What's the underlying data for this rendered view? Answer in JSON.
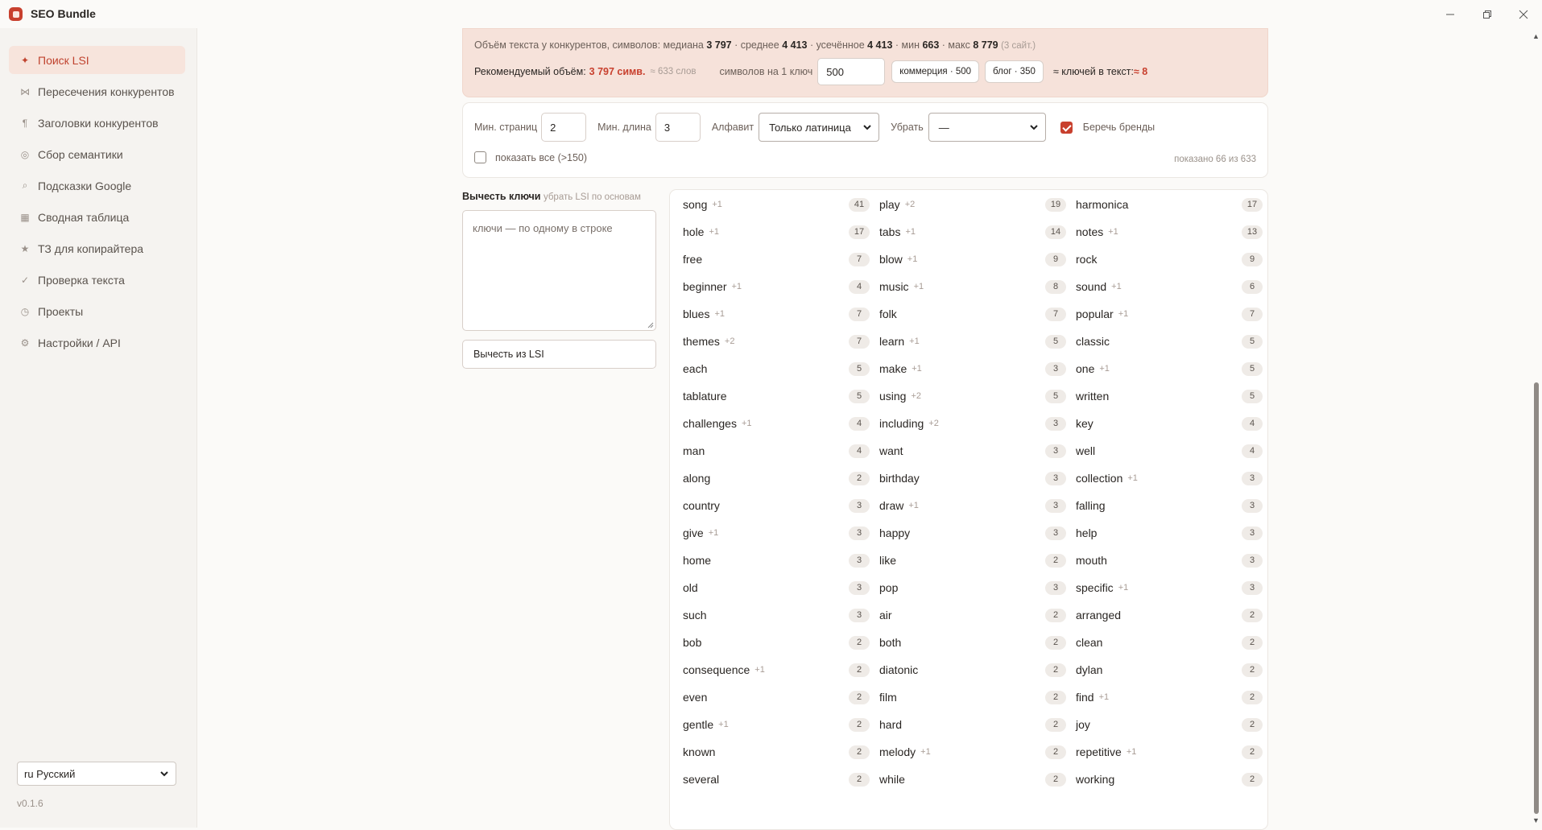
{
  "window": {
    "title": "SEO Bundle",
    "icons": [
      "minimize-icon",
      "restore-icon",
      "close-icon"
    ]
  },
  "sidebar": {
    "items": [
      {
        "label": "Поиск LSI",
        "icon": "✦",
        "active": true
      },
      {
        "label": "Пересечения конкурентов",
        "icon": "⋈"
      },
      {
        "label": "Заголовки конкурентов",
        "icon": "¶"
      },
      {
        "label": "Сбор семантики",
        "icon": "◎"
      },
      {
        "label": "Подсказки Google",
        "icon": "⌕"
      },
      {
        "label": "Сводная таблица",
        "icon": "▦"
      },
      {
        "label": "ТЗ для копирайтера",
        "icon": "★"
      },
      {
        "label": "Проверка текста",
        "icon": "✓"
      },
      {
        "label": "Проекты",
        "icon": "◷"
      },
      {
        "label": "Настройки / API",
        "icon": "⚙"
      }
    ],
    "language": "ru Русский",
    "version": "v0.1.6"
  },
  "stats": {
    "prefix": "Объём текста у конкурентов, символов: медиана ",
    "median": "3 797",
    "avg_label": " · среднее ",
    "avg": "4 413",
    "trim_label": " · усечённое ",
    "trim": "4 413",
    "min_label": " · мин ",
    "min": "663",
    "max_label": " · макс ",
    "max": "8 779",
    "sites": "(3 сайт.)",
    "recommended_label": "Рекомендуемый объём: ",
    "recommended": "3 797 симв.",
    "words": "≈ 633 слов",
    "per_key_label": "символов на 1 ключ",
    "per_key_value": "500",
    "chip_commerce": "коммерция · 500",
    "chip_blog": "блог · 350",
    "keys_label": "≈ ключей в текст: ",
    "keys_value": "≈ 8"
  },
  "filters": {
    "min_pages_label": "Мин. страниц",
    "min_pages": "2",
    "min_len_label": "Мин. длина",
    "min_len": "3",
    "alphabet_label": "Алфавит",
    "alphabet": "Только латиница",
    "remove_label": "Убрать",
    "remove": "—",
    "brands_label": "Беречь бренды",
    "brands_checked": true,
    "show_all_label": "показать все (>150)",
    "show_all_checked": false,
    "shown": "показано 66 из 633"
  },
  "subtract": {
    "title": "Вычесть ключи",
    "hint": "убрать LSI по основам",
    "placeholder": "ключи — по одному в строке",
    "button": "Вычесть из LSI"
  },
  "lsi_columns": [
    [
      {
        "w": "song",
        "p": "+1",
        "c": "41"
      },
      {
        "w": "hole",
        "p": "+1",
        "c": "17"
      },
      {
        "w": "free",
        "p": "",
        "c": "7"
      },
      {
        "w": "beginner",
        "p": "+1",
        "c": "4"
      },
      {
        "w": "blues",
        "p": "+1",
        "c": "7"
      },
      {
        "w": "themes",
        "p": "+2",
        "c": "7"
      },
      {
        "w": "each",
        "p": "",
        "c": "5"
      },
      {
        "w": "tablature",
        "p": "",
        "c": "5"
      },
      {
        "w": "challenges",
        "p": "+1",
        "c": "4"
      },
      {
        "w": "man",
        "p": "",
        "c": "4"
      },
      {
        "w": "along",
        "p": "",
        "c": "2"
      },
      {
        "w": "country",
        "p": "",
        "c": "3"
      },
      {
        "w": "give",
        "p": "+1",
        "c": "3"
      },
      {
        "w": "home",
        "p": "",
        "c": "3"
      },
      {
        "w": "old",
        "p": "",
        "c": "3"
      },
      {
        "w": "such",
        "p": "",
        "c": "3"
      },
      {
        "w": "bob",
        "p": "",
        "c": "2"
      },
      {
        "w": "consequence",
        "p": "+1",
        "c": "2"
      },
      {
        "w": "even",
        "p": "",
        "c": "2"
      },
      {
        "w": "gentle",
        "p": "+1",
        "c": "2"
      },
      {
        "w": "known",
        "p": "",
        "c": "2"
      },
      {
        "w": "several",
        "p": "",
        "c": "2"
      }
    ],
    [
      {
        "w": "play",
        "p": "+2",
        "c": "19"
      },
      {
        "w": "tabs",
        "p": "+1",
        "c": "14"
      },
      {
        "w": "blow",
        "p": "+1",
        "c": "9"
      },
      {
        "w": "music",
        "p": "+1",
        "c": "8"
      },
      {
        "w": "folk",
        "p": "",
        "c": "7"
      },
      {
        "w": "learn",
        "p": "+1",
        "c": "5"
      },
      {
        "w": "make",
        "p": "+1",
        "c": "3"
      },
      {
        "w": "using",
        "p": "+2",
        "c": "5"
      },
      {
        "w": "including",
        "p": "+2",
        "c": "3"
      },
      {
        "w": "want",
        "p": "",
        "c": "3"
      },
      {
        "w": "birthday",
        "p": "",
        "c": "3"
      },
      {
        "w": "draw",
        "p": "+1",
        "c": "3"
      },
      {
        "w": "happy",
        "p": "",
        "c": "3"
      },
      {
        "w": "like",
        "p": "",
        "c": "2"
      },
      {
        "w": "pop",
        "p": "",
        "c": "3"
      },
      {
        "w": "air",
        "p": "",
        "c": "2"
      },
      {
        "w": "both",
        "p": "",
        "c": "2"
      },
      {
        "w": "diatonic",
        "p": "",
        "c": "2"
      },
      {
        "w": "film",
        "p": "",
        "c": "2"
      },
      {
        "w": "hard",
        "p": "",
        "c": "2"
      },
      {
        "w": "melody",
        "p": "+1",
        "c": "2"
      },
      {
        "w": "while",
        "p": "",
        "c": "2"
      }
    ],
    [
      {
        "w": "harmonica",
        "p": "",
        "c": "17"
      },
      {
        "w": "notes",
        "p": "+1",
        "c": "13"
      },
      {
        "w": "rock",
        "p": "",
        "c": "9"
      },
      {
        "w": "sound",
        "p": "+1",
        "c": "6"
      },
      {
        "w": "popular",
        "p": "+1",
        "c": "7"
      },
      {
        "w": "classic",
        "p": "",
        "c": "5"
      },
      {
        "w": "one",
        "p": "+1",
        "c": "5"
      },
      {
        "w": "written",
        "p": "",
        "c": "5"
      },
      {
        "w": "key",
        "p": "",
        "c": "4"
      },
      {
        "w": "well",
        "p": "",
        "c": "4"
      },
      {
        "w": "collection",
        "p": "+1",
        "c": "3"
      },
      {
        "w": "falling",
        "p": "",
        "c": "3"
      },
      {
        "w": "help",
        "p": "",
        "c": "3"
      },
      {
        "w": "mouth",
        "p": "",
        "c": "3"
      },
      {
        "w": "specific",
        "p": "+1",
        "c": "3"
      },
      {
        "w": "arranged",
        "p": "",
        "c": "2"
      },
      {
        "w": "clean",
        "p": "",
        "c": "2"
      },
      {
        "w": "dylan",
        "p": "",
        "c": "2"
      },
      {
        "w": "find",
        "p": "+1",
        "c": "2"
      },
      {
        "w": "joy",
        "p": "",
        "c": "2"
      },
      {
        "w": "repetitive",
        "p": "+1",
        "c": "2"
      },
      {
        "w": "working",
        "p": "",
        "c": "2"
      }
    ]
  ]
}
